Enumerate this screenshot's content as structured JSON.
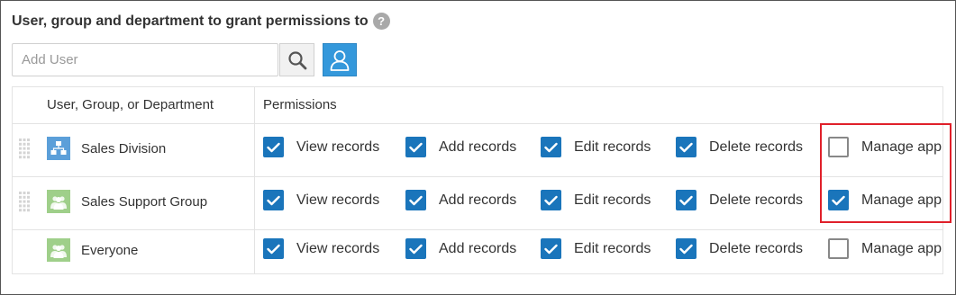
{
  "heading": "User, group and department to grant permissions to",
  "help_icon_glyph": "?",
  "search": {
    "placeholder": "Add User",
    "value": ""
  },
  "table": {
    "columns": [
      "User, Group, or Department",
      "Permissions"
    ],
    "rows": [
      {
        "name": "Sales Division",
        "icon": "department-icon",
        "draggable": true,
        "permissions": [
          {
            "label": "View records",
            "checked": true
          },
          {
            "label": "Add records",
            "checked": true
          },
          {
            "label": "Edit records",
            "checked": true
          },
          {
            "label": "Delete records",
            "checked": true
          },
          {
            "label": "Manage app",
            "checked": false
          }
        ]
      },
      {
        "name": "Sales Support Group",
        "icon": "group-icon",
        "draggable": true,
        "permissions": [
          {
            "label": "View records",
            "checked": true
          },
          {
            "label": "Add records",
            "checked": true
          },
          {
            "label": "Edit records",
            "checked": true
          },
          {
            "label": "Delete records",
            "checked": true
          },
          {
            "label": "Manage app",
            "checked": true
          }
        ]
      },
      {
        "name": "Everyone",
        "icon": "group-icon",
        "draggable": false,
        "permissions": [
          {
            "label": "View records",
            "checked": true
          },
          {
            "label": "Add records",
            "checked": true
          },
          {
            "label": "Edit records",
            "checked": true
          },
          {
            "label": "Delete records",
            "checked": true
          },
          {
            "label": "Manage app",
            "checked": false
          }
        ]
      }
    ]
  },
  "colors": {
    "accent": "#1a75bb",
    "highlight": "#e0202a",
    "department_icon": "#5b9fd9",
    "group_icon": "#9fcf8a"
  }
}
